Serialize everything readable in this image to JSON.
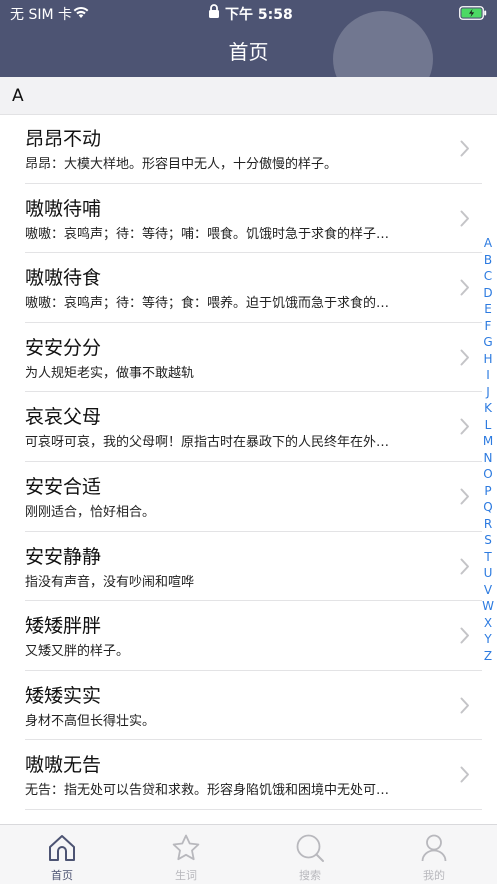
{
  "status_bar": {
    "carrier": "无 SIM 卡",
    "time": "下午 5:58"
  },
  "nav": {
    "title": "首页"
  },
  "section": {
    "letter": "A"
  },
  "rows": [
    {
      "word": "昂昂不动",
      "desc": "昂昂：大模大样地。形容目中无人，十分傲慢的样子。"
    },
    {
      "word": "嗷嗷待哺",
      "desc": "嗷嗷：哀鸣声；待：等待；哺：喂食。饥饿时急于求食的样子…"
    },
    {
      "word": "嗷嗷待食",
      "desc": "嗷嗷：哀鸣声；待：等待；食：喂养。迫于饥饿而急于求食的…"
    },
    {
      "word": "安安分分",
      "desc": "为人规矩老实，做事不敢越轨"
    },
    {
      "word": "哀哀父母",
      "desc": "可哀呀可哀，我的父母啊！原指古时在暴政下的人民终年在外…"
    },
    {
      "word": "安安合适",
      "desc": "刚刚适合，恰好相合。"
    },
    {
      "word": "安安静静",
      "desc": "指没有声音，没有吵闹和喧哗"
    },
    {
      "word": "矮矮胖胖",
      "desc": "又矮又胖的样子。"
    },
    {
      "word": "矮矮实实",
      "desc": "身材不高但长得壮实。"
    },
    {
      "word": "嗷嗷无告",
      "desc": "无告：指无处可以告贷和求救。形容身陷饥饿和困境中无处可…"
    }
  ],
  "index_letters": [
    "A",
    "B",
    "C",
    "D",
    "E",
    "F",
    "G",
    "H",
    "I",
    "J",
    "K",
    "L",
    "M",
    "N",
    "O",
    "P",
    "Q",
    "R",
    "S",
    "T",
    "U",
    "V",
    "W",
    "X",
    "Y",
    "Z"
  ],
  "tabs": [
    {
      "label": "首页",
      "icon": "home-icon",
      "active": true
    },
    {
      "label": "生词",
      "icon": "star-icon",
      "active": false
    },
    {
      "label": "搜索",
      "icon": "search-icon",
      "active": false
    },
    {
      "label": "我的",
      "icon": "user-icon",
      "active": false
    }
  ],
  "colors": {
    "nav_bg": "#4d5473",
    "index_link": "#2d7be0",
    "tab_active": "#4d5473",
    "tab_inactive": "#b8b8bd",
    "battery_fill": "#4cd964"
  }
}
